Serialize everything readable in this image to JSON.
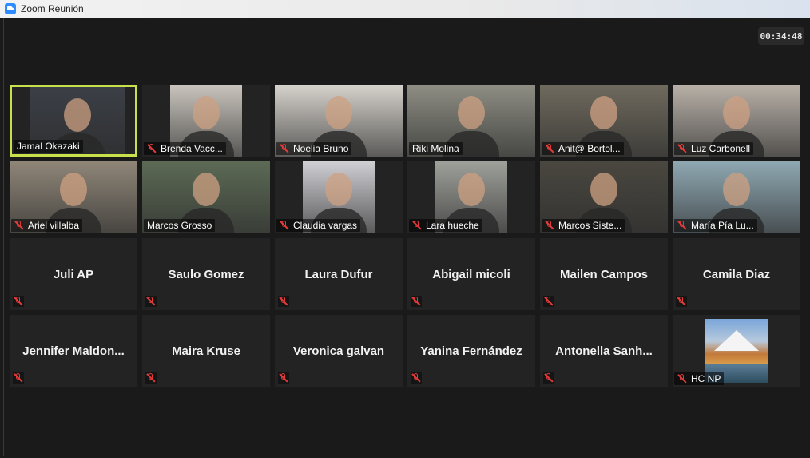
{
  "window": {
    "title": "Zoom Reunión"
  },
  "meeting": {
    "timer": "00:34:48"
  },
  "rows": [
    [
      {
        "name": "Jamal Okazaki",
        "muted": false,
        "active": true,
        "video": "#3b3f46"
      },
      {
        "name": "Brenda Vacc...",
        "muted": true,
        "video": "#c9c4bd"
      },
      {
        "name": "Noelia Bruno",
        "muted": true,
        "video": "#d6d2cc"
      },
      {
        "name": "Riki Molina",
        "muted": false,
        "video": "#8e8e84"
      },
      {
        "name": "Anit@ Bortol...",
        "muted": true,
        "video": "#6f6a5e"
      },
      {
        "name": "Luz Carbonell",
        "muted": true,
        "video": "#b9b1a8"
      }
    ],
    [
      {
        "name": "Ariel villalba",
        "muted": true,
        "video": "#8f8678"
      },
      {
        "name": "Marcos Grosso",
        "muted": false,
        "video": "#5c6a55"
      },
      {
        "name": "Claudia vargas",
        "muted": true,
        "video": "#cfcfd4"
      },
      {
        "name": "Lara hueche",
        "muted": true,
        "video": "#9ea09a"
      },
      {
        "name": "Marcos Siste...",
        "muted": true,
        "video": "#4a4740"
      },
      {
        "name": "María Pía Lu...",
        "muted": true,
        "video": "#8fa8b2"
      }
    ],
    [
      {
        "name": "Juli AP"
      },
      {
        "name": "Saulo Gomez"
      },
      {
        "name": "Laura Dufur"
      },
      {
        "name": "Abigail micoli"
      },
      {
        "name": "Mailen Campos"
      },
      {
        "name": "Camila Diaz"
      }
    ],
    [
      {
        "name": "Jennifer  Maldon..."
      },
      {
        "name": "Maira Kruse"
      },
      {
        "name": "Veronica galvan"
      },
      {
        "name": "Yanina Fernández"
      },
      {
        "name": "Antonella  Sanh..."
      },
      {
        "name": "HC NP",
        "avatar": true
      }
    ]
  ]
}
